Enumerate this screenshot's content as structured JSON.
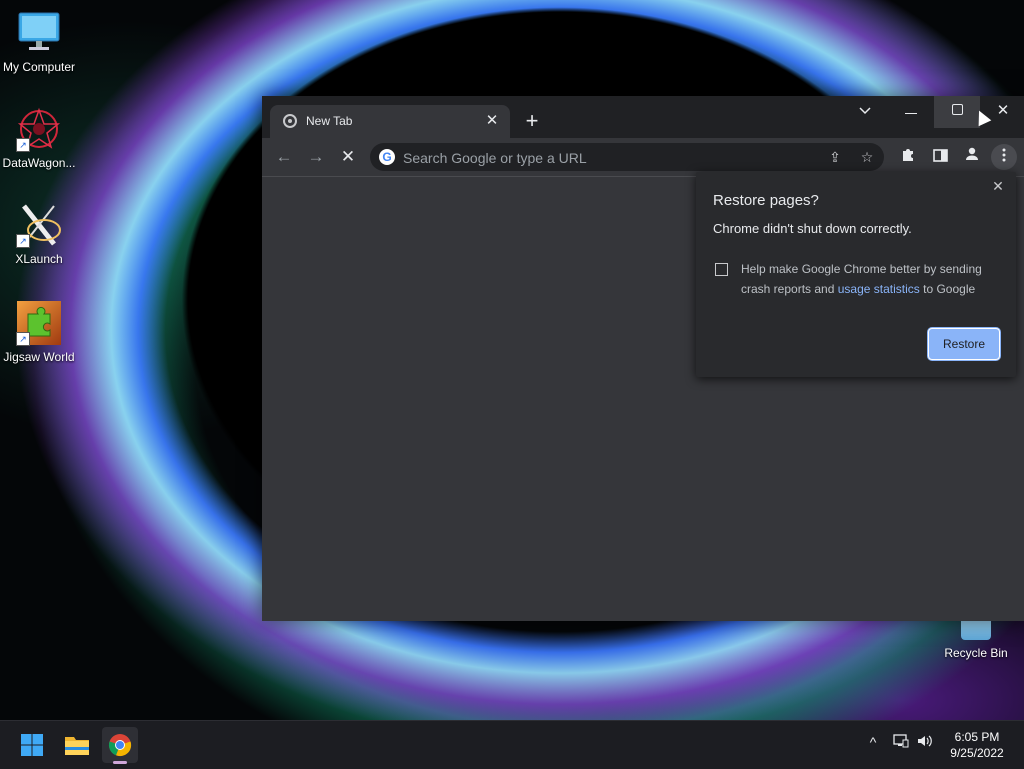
{
  "desktop": {
    "icons": [
      {
        "label": "My Computer"
      },
      {
        "label": "DataWagon..."
      },
      {
        "label": "XLaunch"
      },
      {
        "label": "Jigsaw World"
      }
    ],
    "recycle_bin": "Recycle Bin"
  },
  "browser": {
    "tab_title": "New Tab",
    "omnibox_placeholder": "Search Google or type a URL",
    "restore_popup": {
      "title": "Restore pages?",
      "message": "Chrome didn't shut down correctly.",
      "checkbox_text_1": "Help make Google Chrome better by sending crash reports and",
      "checkbox_link": "usage statistics",
      "checkbox_text_2": "to Google",
      "restore_label": "Restore"
    }
  },
  "taskbar": {
    "time": "6:05 PM",
    "date": "9/25/2022"
  }
}
